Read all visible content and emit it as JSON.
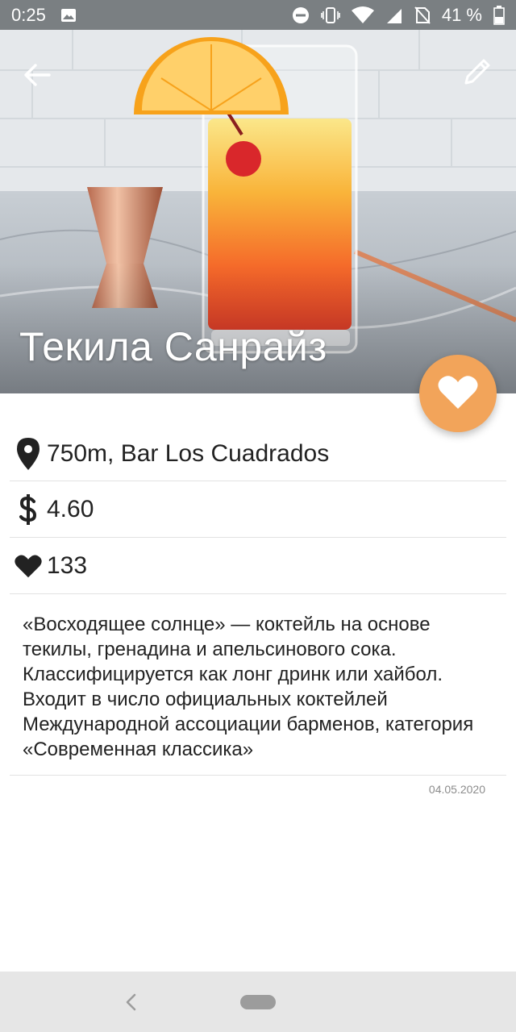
{
  "status_bar": {
    "time": "0:25",
    "battery": "41 %",
    "icons": [
      "image-icon",
      "do-not-disturb-icon",
      "vibrate-icon",
      "wifi-icon",
      "signal-icon",
      "no-sim-icon",
      "battery-icon"
    ]
  },
  "hero": {
    "title": "Текила Санрайз",
    "back_icon": "arrow-left-icon",
    "edit_icon": "pencil-icon"
  },
  "fab": {
    "icon": "heart-icon",
    "color": "#f2a45a"
  },
  "details": {
    "location": "750m, Bar Los Cuadrados",
    "price": "4.60",
    "likes": "133",
    "description": "«Восходящее солнце» — коктейль на основе текилы, гренадина и апельсинового сока. Классифицируется как лонг дринк или хайбол. Входит в число официальных коктейлей Международной ассоциации барменов, категория «Современная классика»",
    "date": "04.05.2020"
  },
  "nav_bar": {
    "back_icon": "nav-back-icon",
    "home_icon": "home-pill-icon"
  }
}
